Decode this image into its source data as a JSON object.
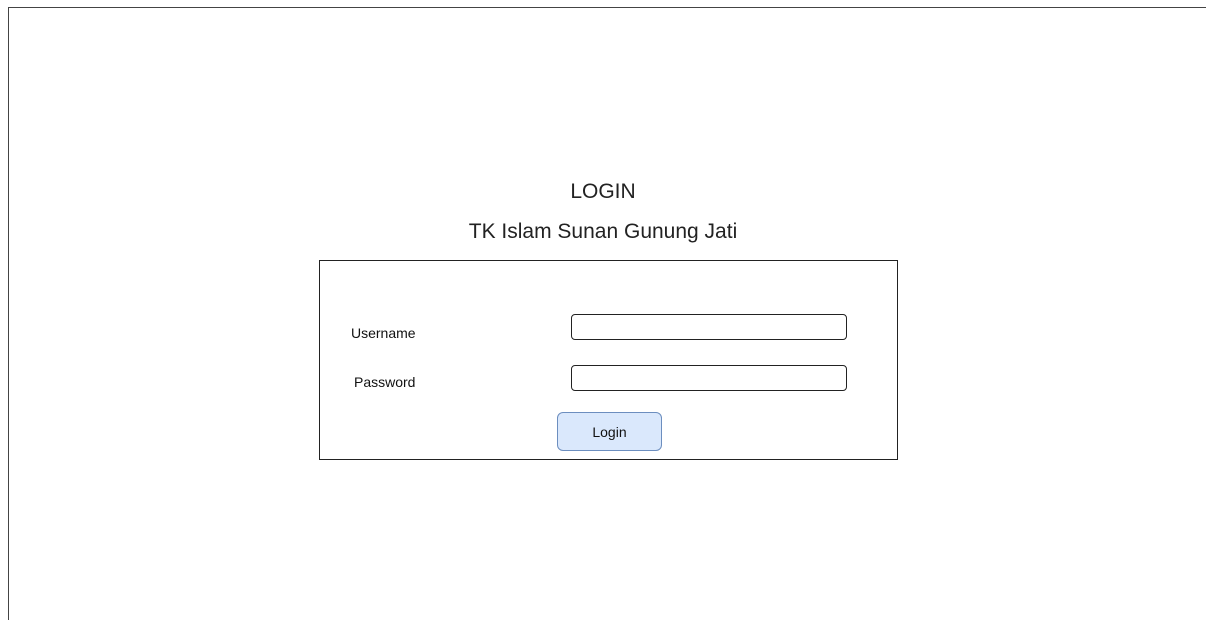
{
  "header": {
    "title": "LOGIN",
    "subtitle": "TK Islam Sunan Gunung Jati"
  },
  "form": {
    "username_label": "Username",
    "username_value": "",
    "password_label": "Password",
    "password_value": "",
    "submit_label": "Login"
  },
  "colors": {
    "button_fill": "#dae8fc",
    "button_border": "#6c8ebf",
    "border": "#222222",
    "background": "#ffffff"
  }
}
